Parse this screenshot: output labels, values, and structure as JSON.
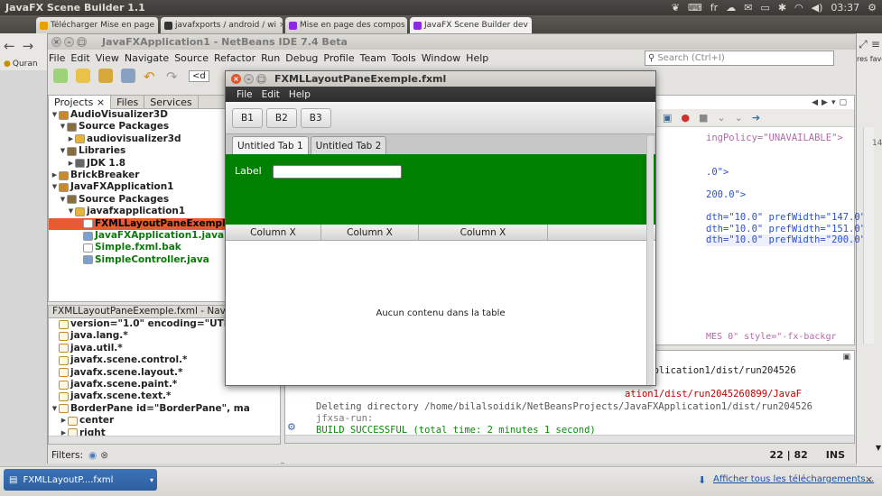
{
  "topbar": {
    "app_title": "JavaFX Scene Builder 1.1",
    "keyboard": "fr",
    "time": "03:37"
  },
  "browser_tabs": [
    {
      "label": "Télécharger Mise en page",
      "color": "#e8a200"
    },
    {
      "label": "javafxports / android / wi",
      "color": "#333333"
    },
    {
      "label": "Mise en page des compos",
      "color": "#8a2be2"
    },
    {
      "label": "JavaFX Scene Builder dev",
      "color": "#8a2be2"
    }
  ],
  "browser": {
    "bookmark_stub": "Quran",
    "bookmarks_right": "res favoris"
  },
  "netbeans": {
    "title": "JavaFXApplication1 - NetBeans IDE 7.4 Beta",
    "menu": [
      "File",
      "Edit",
      "View",
      "Navigate",
      "Source",
      "Refactor",
      "Run",
      "Debug",
      "Profile",
      "Team",
      "Tools",
      "Window",
      "Help"
    ],
    "search_placeholder": "Search (Ctrl+I)",
    "combo_stub": "<d",
    "project_tabs": [
      "Projects",
      "Files",
      "Services"
    ],
    "tree": [
      {
        "label": "AudioVisualizer3D",
        "depth": 0,
        "arrow": "▼",
        "icon": "#c88a2a",
        "color": "#222"
      },
      {
        "label": "Source Packages",
        "depth": 1,
        "arrow": "▼",
        "icon": "#8a6d3b",
        "color": "#222"
      },
      {
        "label": "audiovisualizer3d",
        "depth": 2,
        "arrow": "▶",
        "icon": "#e6b43a",
        "color": "#222"
      },
      {
        "label": "Libraries",
        "depth": 1,
        "arrow": "▼",
        "icon": "#8a6d3b",
        "color": "#222"
      },
      {
        "label": "JDK 1.8",
        "depth": 2,
        "arrow": "▶",
        "icon": "#666666",
        "color": "#222"
      },
      {
        "label": "BrickBreaker",
        "depth": 0,
        "arrow": "▶",
        "icon": "#c88a2a",
        "color": "#222"
      },
      {
        "label": "JavaFXApplication1",
        "depth": 0,
        "arrow": "▼",
        "icon": "#c88a2a",
        "color": "#222"
      },
      {
        "label": "Source Packages",
        "depth": 1,
        "arrow": "▼",
        "icon": "#8a6d3b",
        "color": "#222"
      },
      {
        "label": "javafxapplication1",
        "depth": 2,
        "arrow": "▼",
        "icon": "#e6b43a",
        "color": "#222"
      },
      {
        "label": "FXMLLayoutPaneExemple.",
        "depth": 3,
        "arrow": "",
        "icon": "#ffffff",
        "color": "#222",
        "selected": true
      },
      {
        "label": "JavaFXApplication1.java",
        "depth": 3,
        "arrow": "",
        "icon": "#7aa1d6",
        "color": "#0a7a0a"
      },
      {
        "label": "Simple.fxml.bak",
        "depth": 3,
        "arrow": "",
        "icon": "#ffffff",
        "color": "#0a7a0a"
      },
      {
        "label": "SimpleController.java",
        "depth": 3,
        "arrow": "",
        "icon": "#7aa1d6",
        "color": "#0a7a0a"
      }
    ],
    "navigator_title": "FXMLLayoutPaneExemple.fxml - Navig",
    "navigator": [
      {
        "label": "version=\"1.0\" encoding=\"UTF-8\"",
        "arrow": "",
        "depth": 0
      },
      {
        "label": "java.lang.*",
        "arrow": "",
        "depth": 0
      },
      {
        "label": "java.util.*",
        "arrow": "",
        "depth": 0
      },
      {
        "label": "javafx.scene.control.*",
        "arrow": "",
        "depth": 0
      },
      {
        "label": "javafx.scene.layout.*",
        "arrow": "",
        "depth": 0
      },
      {
        "label": "javafx.scene.paint.*",
        "arrow": "",
        "depth": 0
      },
      {
        "label": "javafx.scene.text.*",
        "arrow": "",
        "depth": 0
      },
      {
        "label": "BorderPane id=\"BorderPane\", ma",
        "arrow": "▼",
        "depth": 0
      },
      {
        "label": "center",
        "arrow": "▶",
        "depth": 1
      },
      {
        "label": "right",
        "arrow": "▶",
        "depth": 1
      }
    ],
    "filters_label": "Filters:",
    "editor_lines": [
      {
        "text": "ingPolicy=\"UNAVAILABLE\">",
        "color": "#b36aa8"
      },
      {
        "text": "",
        "color": "#222"
      },
      {
        "text": "",
        "color": "#222"
      },
      {
        "text": ".0\">",
        "color": "#2a4fd0"
      },
      {
        "text": "",
        "color": "#222"
      },
      {
        "text": "200.0\">",
        "color": "#2a4fd0"
      },
      {
        "text": "",
        "color": "#222"
      },
      {
        "text": "dth=\"10.0\" prefWidth=\"147.0\"",
        "color": "#2a4fd0"
      },
      {
        "text": "dth=\"10.0\" prefWidth=\"151.0\"",
        "color": "#2a4fd0"
      },
      {
        "text": "dth=\"10.0\" prefWidth=\"200.0\"",
        "color": "#2a4fd0"
      }
    ],
    "editor_partial_line": "MES 0\" style=\"-fx-backgr",
    "editor_gutter": "14",
    "output_lines": [
      {
        "text": "aFXApplication1/dist/run204526",
        "color": "#222"
      },
      {
        "text": "",
        "color": "#222"
      },
      {
        "text": "ation1/dist/run2045260899/JavaF",
        "color": "#c00000"
      },
      {
        "text": "Deleting directory /home/bilalsoidik/NetBeansProjects/JavaFXApplication1/dist/run204526",
        "color": "#555"
      },
      {
        "text": "jfxsa-run:",
        "color": "#777"
      },
      {
        "text": "BUILD SUCCESSFUL (total time: 2 minutes 1 second)",
        "color": "#0a8a0a"
      }
    ],
    "cursor_pos": "22 | 82",
    "insert_mode": "INS"
  },
  "fx_window": {
    "title": "FXMLLayoutPaneExemple.fxml",
    "menu": [
      "File",
      "Edit",
      "Help"
    ],
    "buttons": [
      "B1",
      "B2",
      "B3"
    ],
    "tabs": [
      "Untitled Tab 1",
      "Untitled Tab 2"
    ],
    "label": "Label",
    "columns": [
      "Column X",
      "Column X",
      "Column X"
    ],
    "empty_table": "Aucun contenu dans la table"
  },
  "downloads": {
    "item": "FXMLLayoutP....fxml",
    "show_all": "Afficher tous les téléchargements..."
  }
}
